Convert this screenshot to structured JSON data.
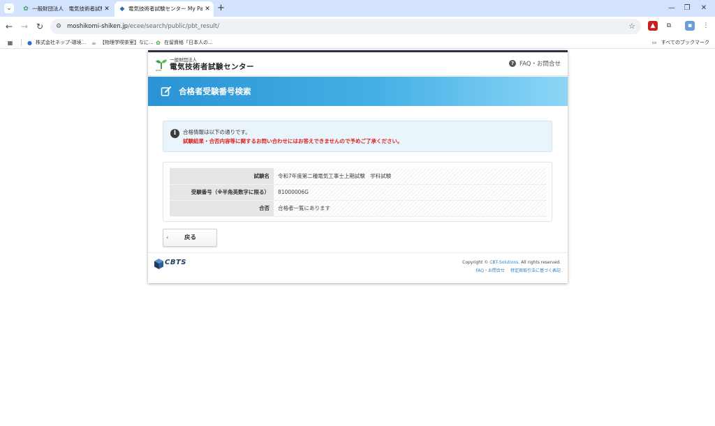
{
  "browser": {
    "tabs": [
      {
        "title": "一般財団法人　電気技術者試験センター",
        "active": false
      },
      {
        "title": "電気技術者試験センター My Page",
        "active": true
      }
    ],
    "new_tab_glyph": "+",
    "url_host": "moshikomi-shiken.jp",
    "url_path": "/ecee/search/public/pbt_result/",
    "bookmarks": [
      {
        "label": "株式会社ネップ-環境..."
      },
      {
        "label": "【物理学喫茶室】なに..."
      },
      {
        "label": "在留資格「日本人の..."
      }
    ],
    "all_bookmarks_label": "すべてのブックマーク"
  },
  "header": {
    "org_small": "一般財団法人",
    "org_name": "電気技術者試験センター",
    "faq_label": "FAQ・お問合せ"
  },
  "banner": {
    "title": "合格者受験番号検索"
  },
  "notice": {
    "line1": "合格情報は以下の通りです。",
    "line2": "試験結果・合否内容等に関するお問い合わせにはお答えできませんので予めご了承ください。"
  },
  "result": {
    "rows": [
      {
        "label": "試験名",
        "value": "令和7年度第二種電気工事士上期試験　学科試験"
      },
      {
        "label": "受験番号（※半角英数字に限る）",
        "value": "81000006G"
      },
      {
        "label": "合否",
        "value": "合格者一覧にあります"
      }
    ]
  },
  "back_button": {
    "label": "戻る"
  },
  "footer": {
    "brand": "CBTS",
    "copyright_prefix": "Copyright © ",
    "copyright_link": "CBT-Solutions",
    "copyright_suffix": ". All rights reserved.",
    "links": [
      "FAQ・お問合せ",
      "特定商取引法に基づく表記"
    ]
  },
  "colors": {
    "banner_start": "#2a93d5",
    "banner_end": "#8dd6f6",
    "warning_text": "#e02020",
    "notice_bg": "#eaf5fb",
    "tabstrip": "#d3e3fd"
  },
  "icons": [
    "tab-search-icon",
    "leaf-favicon",
    "cube-favicon",
    "back-icon",
    "forward-icon",
    "reload-icon",
    "site-info-icon",
    "star-icon",
    "pdf-extension-icon",
    "extensions-icon",
    "profile-icon",
    "kebab-menu-icon",
    "apps-icon",
    "folder-icon",
    "faq-question-icon",
    "edit-icon",
    "info-icon",
    "chevron-left-icon"
  ]
}
